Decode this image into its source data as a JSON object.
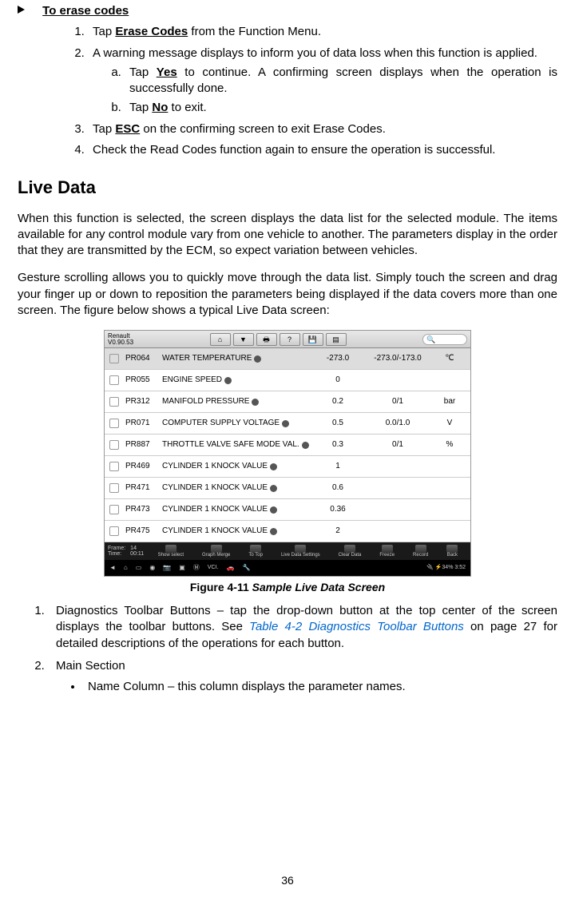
{
  "header": {
    "section_title": "To erase codes",
    "items": [
      {
        "pre": "Tap ",
        "bold": "Erase Codes",
        "post": " from the Function Menu."
      },
      {
        "full": "A warning message displays to inform you of data loss when this function is applied.",
        "sub": [
          {
            "pre": "Tap ",
            "bold": "Yes",
            "post": " to continue. A confirming screen displays when the operation is successfully done."
          },
          {
            "pre": "Tap ",
            "bold": "No",
            "post": " to exit."
          }
        ]
      },
      {
        "pre": "Tap ",
        "bold": "ESC",
        "post": " on the confirming screen to exit Erase Codes."
      },
      {
        "full": "Check the Read Codes function again to ensure the operation is successful."
      }
    ]
  },
  "h2": "Live Data",
  "paras": {
    "p1": "When this function is selected, the screen displays the data list for the selected module. The items available for any control module vary from one vehicle to another. The parameters display in the order that they are transmitted by the ECM, so expect variation between vehicles.",
    "p2": "Gesture scrolling allows you to quickly move through the data list. Simply touch the screen and drag your finger up or down to reposition the parameters being displayed if the data covers more than one screen. The figure below shows a typical Live Data screen:"
  },
  "ss": {
    "title_l1": "Renault",
    "title_l2": "V0.90.53",
    "search_icon": "🔍",
    "rows": [
      {
        "first": true,
        "id": "PR064",
        "name": "WATER TEMPERATURE",
        "val": "-273.0",
        "range": "-273.0/-173.0",
        "unit": "℃"
      },
      {
        "id": "PR055",
        "name": "ENGINE SPEED",
        "val": "0",
        "range": "",
        "unit": ""
      },
      {
        "id": "PR312",
        "name": "MANIFOLD PRESSURE",
        "val": "0.2",
        "range": "0/1",
        "unit": "bar"
      },
      {
        "id": "PR071",
        "name": "COMPUTER SUPPLY VOLTAGE",
        "val": "0.5",
        "range": "0.0/1.0",
        "unit": "V"
      },
      {
        "id": "PR887",
        "name": "THROTTLE VALVE SAFE MODE VAL.",
        "val": "0.3",
        "range": "0/1",
        "unit": "%"
      },
      {
        "id": "PR469",
        "name": "CYLINDER 1 KNOCK VALUE",
        "val": "1",
        "range": "",
        "unit": ""
      },
      {
        "id": "PR471",
        "name": "CYLINDER 1 KNOCK VALUE",
        "val": "0.6",
        "range": "",
        "unit": ""
      },
      {
        "id": "PR473",
        "name": "CYLINDER 1 KNOCK VALUE",
        "val": "0.36",
        "range": "",
        "unit": ""
      },
      {
        "id": "PR475",
        "name": "CYLINDER 1 KNOCK VALUE",
        "val": "2",
        "range": "",
        "unit": ""
      }
    ],
    "bottom": {
      "frame_label": "Frame:",
      "frame_val": "14",
      "time_label": "Time:",
      "time_val": "00:11",
      "btns": [
        "Show select",
        "Graph Merge",
        "To Top",
        "Live Data Settings",
        "Clear Data",
        "Freeze",
        "Record",
        "Back"
      ]
    },
    "nav": {
      "battery": "34%",
      "clock": "3:52"
    }
  },
  "caption": {
    "num": "Figure 4-11 ",
    "title": "Sample Live Data Screen"
  },
  "post": [
    {
      "lead": "Diagnostics Toolbar Buttons – tap the drop-down button at the top center of the screen displays the toolbar buttons. See ",
      "link": "Table 4-2 Diagnostics Toolbar Buttons",
      "tail": " on page 27 for detailed descriptions of the operations for each button."
    },
    {
      "full": "Main Section",
      "bullets": [
        "Name Column – this column displays the parameter names."
      ]
    }
  ],
  "pagenum": "36"
}
